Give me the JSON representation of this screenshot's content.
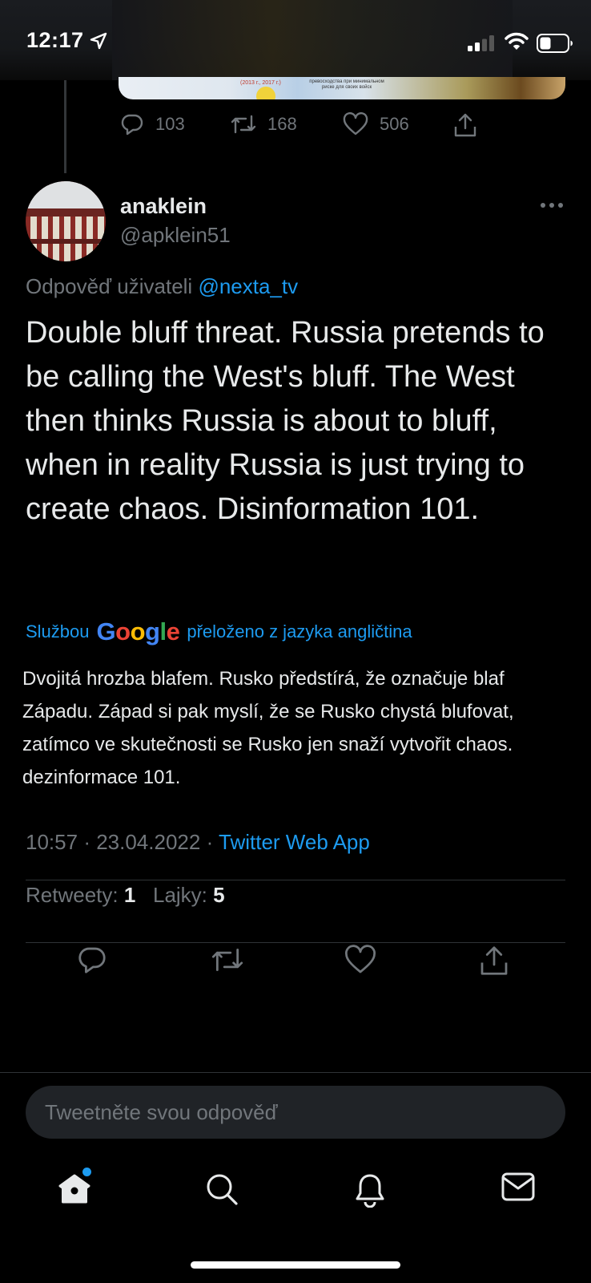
{
  "status_bar": {
    "time": "12:17"
  },
  "parent_tweet": {
    "image_text": "превосходства при минимальном риске для своих войск",
    "image_caption": "(2013 г., 2017 г.)",
    "replies": "103",
    "retweets": "168",
    "likes": "506"
  },
  "tweet": {
    "username": "anaklein",
    "handle": "@apklein51",
    "reply_prefix": "Odpověď uživateli",
    "reply_mention": "@nexta_tv",
    "text": "Double bluff threat. Russia pretends to be calling the West's bluff. The West then thinks Russia is about to bluff, when in reality Russia is just trying to create chaos. Disinformation 101.",
    "translate_prefix": "Službou",
    "translate_suffix": "přeloženo z jazyka angličtina",
    "translated_text": "Dvojitá hrozba blafem. Rusko předstírá, že označuje blaf Západu. Západ si pak myslí, že se Rusko chystá blufovat, zatímco ve skutečnosti se Rusko jen snaží vytvořit chaos. dezinformace 101.",
    "time": "10:57",
    "date": "23.04.2022",
    "source": "Twitter Web App",
    "retweets_label": "Retweety:",
    "retweets_count": "1",
    "likes_label": "Lajky:",
    "likes_count": "5"
  },
  "reply_box": {
    "placeholder": "Tweetněte svou odpověď"
  },
  "colors": {
    "accent": "#1d9bf0",
    "background": "#000000",
    "muted": "#71767b",
    "text": "#e7e9ea"
  },
  "icons": [
    "location-arrow-icon",
    "signal-icon",
    "wifi-icon",
    "battery-icon",
    "reply-icon",
    "retweet-icon",
    "like-icon",
    "share-icon",
    "more-icon",
    "home-icon",
    "search-icon",
    "notifications-icon",
    "messages-icon"
  ]
}
